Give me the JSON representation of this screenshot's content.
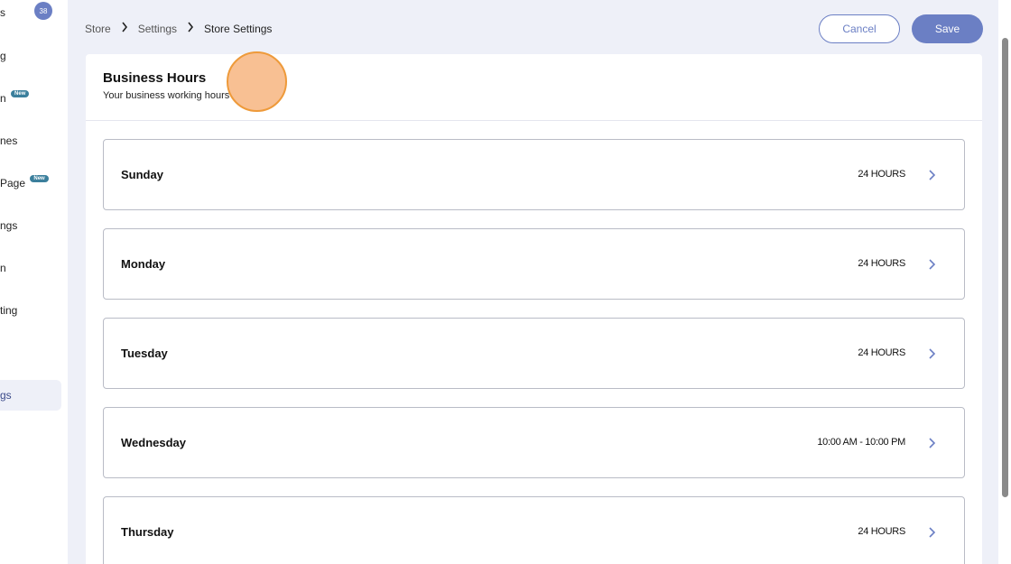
{
  "sidebar": {
    "badge_count": "38",
    "new_label": "New",
    "items": [
      {
        "label": "s"
      },
      {
        "label": "g"
      },
      {
        "label": "n"
      },
      {
        "label": "nes"
      },
      {
        "label": "Page"
      },
      {
        "label": "ngs"
      },
      {
        "label": "n"
      },
      {
        "label": "ting"
      },
      {
        "label": "gs"
      }
    ]
  },
  "breadcrumb": {
    "items": [
      "Store",
      "Settings",
      "Store Settings"
    ]
  },
  "actions": {
    "cancel_label": "Cancel",
    "save_label": "Save"
  },
  "card": {
    "title": "Business Hours",
    "subtitle": "Your business working hours"
  },
  "days": [
    {
      "name": "Sunday",
      "hours": "24 HOURS"
    },
    {
      "name": "Monday",
      "hours": "24 HOURS"
    },
    {
      "name": "Tuesday",
      "hours": "24 HOURS"
    },
    {
      "name": "Wednesday",
      "hours": "10:00 AM - 10:00 PM"
    },
    {
      "name": "Thursday",
      "hours": "24 HOURS"
    }
  ],
  "colors": {
    "accent": "#6b7fc4",
    "background": "#eef0f8",
    "new_badge": "#3b7f9c",
    "cursor": "#ee9a3a"
  }
}
